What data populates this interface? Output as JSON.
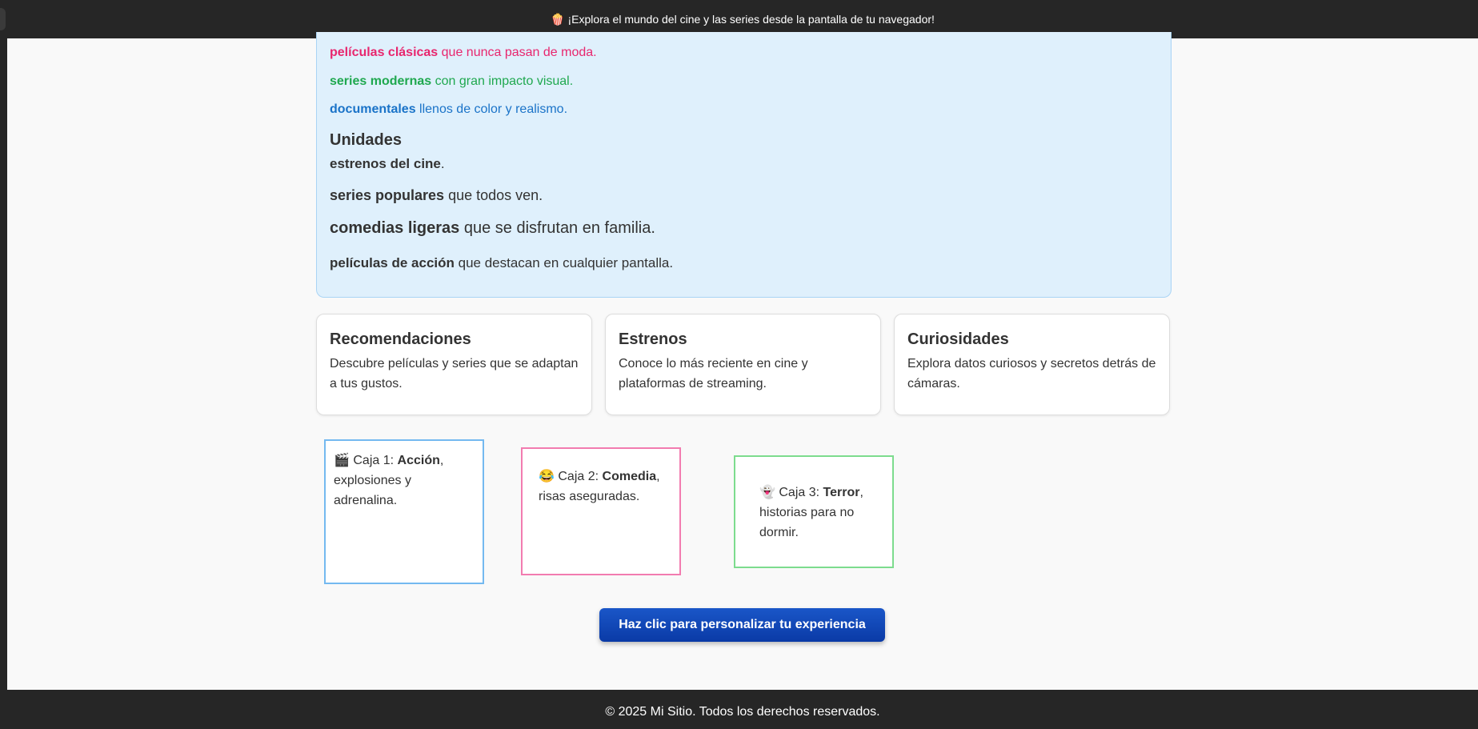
{
  "banner": {
    "emoji": "🍿",
    "text": "¡Explora el mundo del cine y las series desde la pantalla de tu navegador!"
  },
  "info_panel": {
    "lines": [
      {
        "bold": "películas clásicas",
        "rest": " que nunca pasan de moda.",
        "color": "#e8266e"
      },
      {
        "bold": "series modernas",
        "rest": " con gran impacto visual.",
        "color": "#1fa84f"
      },
      {
        "bold": "documentales",
        "rest": " llenos de color y realismo.",
        "color": "#1a73c8"
      }
    ],
    "units_title": "Unidades",
    "units": [
      {
        "bold": "estrenos del cine",
        "rest": "."
      },
      {
        "bold": "series populares",
        "rest": " que todos ven."
      },
      {
        "bold": "comedias ligeras",
        "rest": " que se disfrutan en familia."
      },
      {
        "bold": "películas de acción",
        "rest": " que destacan en cualquier pantalla."
      }
    ]
  },
  "cards": [
    {
      "title": "Recomendaciones",
      "text": "Descubre películas y series que se adaptan a tus gustos."
    },
    {
      "title": "Estrenos",
      "text": "Conoce lo más reciente en cine y plataformas de streaming."
    },
    {
      "title": "Curiosidades",
      "text": "Explora datos curiosos y secretos detrás de cámaras."
    }
  ],
  "boxes": [
    {
      "emoji": "🎬",
      "prefix": " Caja 1: ",
      "genre": "Acción",
      "rest": ", explosiones y adrenalina.",
      "border_color": "#74b9f0"
    },
    {
      "emoji": "😂",
      "prefix": " Caja 2: ",
      "genre": "Comedia",
      "rest": ", risas aseguradas.",
      "border_color": "#f27cb0"
    },
    {
      "emoji": "👻",
      "prefix": " Caja 3: ",
      "genre": "Terror",
      "rest": ", historias para no dormir.",
      "border_color": "#7ddc8e"
    }
  ],
  "cta": {
    "label": "Haz clic para personalizar tu experiencia"
  },
  "footer": {
    "text": "© 2025 Mi Sitio. Todos los derechos reservados."
  }
}
